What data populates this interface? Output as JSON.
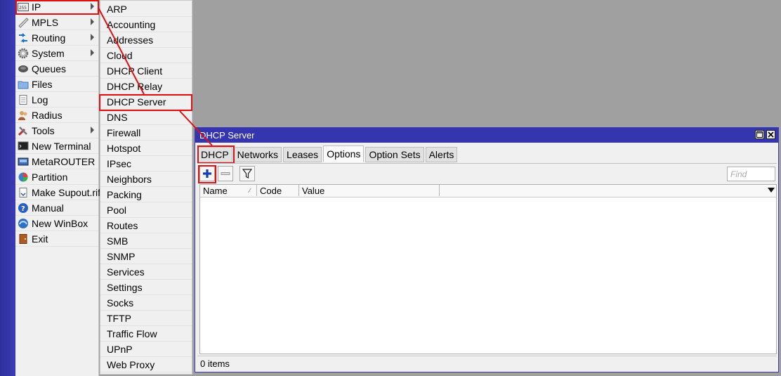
{
  "main_menu": {
    "items": [
      {
        "label": "IP",
        "icon": "ip-address-icon",
        "has_submenu": true
      },
      {
        "label": "MPLS",
        "icon": "mpls-icon",
        "has_submenu": true
      },
      {
        "label": "Routing",
        "icon": "routing-icon",
        "has_submenu": true
      },
      {
        "label": "System",
        "icon": "gear-icon",
        "has_submenu": true
      },
      {
        "label": "Queues",
        "icon": "queues-icon",
        "has_submenu": false
      },
      {
        "label": "Files",
        "icon": "folder-icon",
        "has_submenu": false
      },
      {
        "label": "Log",
        "icon": "log-icon",
        "has_submenu": false
      },
      {
        "label": "Radius",
        "icon": "radius-users-icon",
        "has_submenu": false
      },
      {
        "label": "Tools",
        "icon": "tools-icon",
        "has_submenu": true
      },
      {
        "label": "New Terminal",
        "icon": "terminal-icon",
        "has_submenu": false
      },
      {
        "label": "MetaROUTER",
        "icon": "metarouter-icon",
        "has_submenu": false
      },
      {
        "label": "Partition",
        "icon": "partition-pie-icon",
        "has_submenu": false
      },
      {
        "label": "Make Supout.rif",
        "icon": "supout-icon",
        "has_submenu": false
      },
      {
        "label": "Manual",
        "icon": "help-icon",
        "has_submenu": false
      },
      {
        "label": "New WinBox",
        "icon": "winbox-icon",
        "has_submenu": false
      },
      {
        "label": "Exit",
        "icon": "exit-door-icon",
        "has_submenu": false
      }
    ]
  },
  "ip_submenu": {
    "items": [
      "ARP",
      "Accounting",
      "Addresses",
      "Cloud",
      "DHCP Client",
      "DHCP Relay",
      "DHCP Server",
      "DNS",
      "Firewall",
      "Hotspot",
      "IPsec",
      "Neighbors",
      "Packing",
      "Pool",
      "Routes",
      "SMB",
      "SNMP",
      "Services",
      "Settings",
      "Socks",
      "TFTP",
      "Traffic Flow",
      "UPnP",
      "Web Proxy"
    ]
  },
  "window": {
    "title": "DHCP Server",
    "tabs": [
      "DHCP",
      "Networks",
      "Leases",
      "Options",
      "Option Sets",
      "Alerts"
    ],
    "active_tab": "Options",
    "find_placeholder": "Find",
    "columns": [
      "Name",
      "Code",
      "Value"
    ],
    "status": "0 items"
  },
  "colors": {
    "highlight": "#e01010",
    "titlebar": "#3535b0",
    "accent_blue": "#1a3fb0"
  }
}
